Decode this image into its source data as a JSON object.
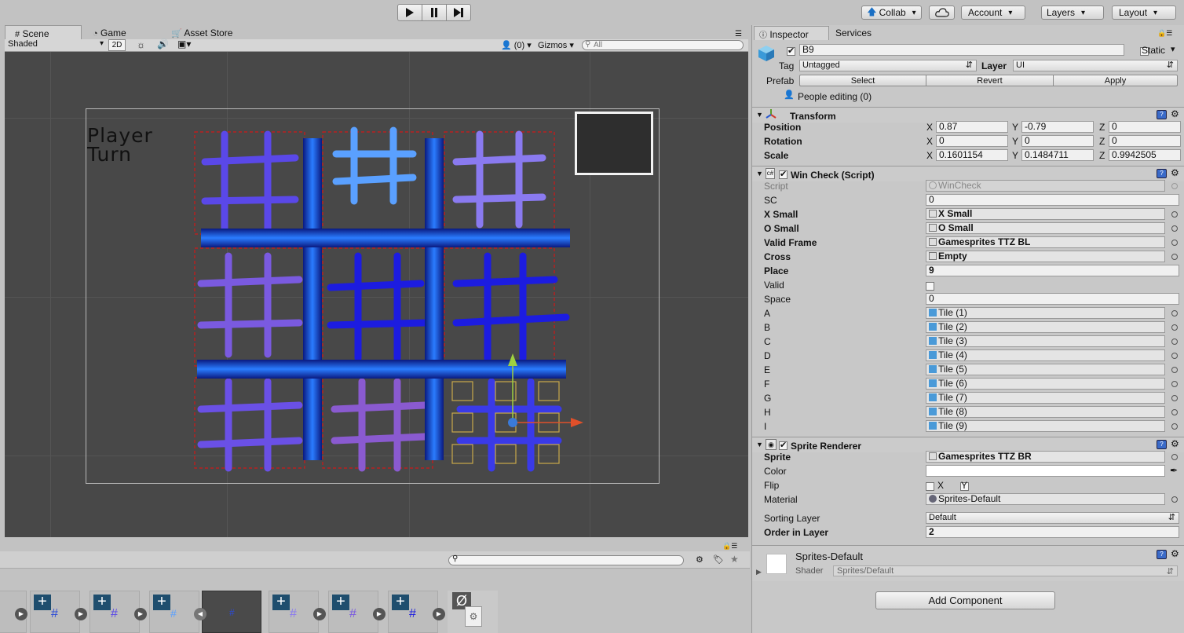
{
  "toolbar": {
    "collab": "Collab",
    "account": "Account",
    "layers": "Layers",
    "layout": "Layout"
  },
  "scene": {
    "tabs": [
      "Scene",
      "Game",
      "Asset Store"
    ],
    "shading": "Shaded",
    "mode_2d": "2D",
    "visibility_count": "(0)",
    "gizmos": "Gizmos",
    "search_placeholder": "All",
    "game_text": "Player\nTurn"
  },
  "inspector": {
    "tabs": [
      "Inspector",
      "Services"
    ],
    "object_name": "B9",
    "static_label": "Static",
    "tag_label": "Tag",
    "tag_value": "Untagged",
    "layer_label": "Layer",
    "layer_value": "UI",
    "prefab_label": "Prefab",
    "prefab_buttons": [
      "Select",
      "Revert",
      "Apply"
    ],
    "people_editing": "People editing (0)",
    "transform": {
      "title": "Transform",
      "rows": [
        {
          "label": "Position",
          "x": "0.87",
          "y": "-0.79",
          "z": "0"
        },
        {
          "label": "Rotation",
          "x": "0",
          "y": "0",
          "z": "0"
        },
        {
          "label": "Scale",
          "x": "0.1601154",
          "y": "0.1484711",
          "z": "0.9942505"
        }
      ]
    },
    "wincheck": {
      "title": "Win Check (Script)",
      "rows": [
        {
          "label": "Script",
          "value": "WinCheck",
          "kind": "script",
          "bold": false
        },
        {
          "label": "SC",
          "value": "0",
          "kind": "text",
          "bold": false
        },
        {
          "label": "X Small",
          "value": "X Small",
          "kind": "obj",
          "bold": true
        },
        {
          "label": "O Small",
          "value": "O Small",
          "kind": "obj",
          "bold": true
        },
        {
          "label": "Valid Frame",
          "value": "Gamesprites TTZ BL",
          "kind": "obj",
          "bold": true
        },
        {
          "label": "Cross",
          "value": "Empty",
          "kind": "obj",
          "bold": true
        },
        {
          "label": "Place",
          "value": "9",
          "kind": "text",
          "bold": true
        },
        {
          "label": "Valid",
          "value": "",
          "kind": "check",
          "bold": false
        },
        {
          "label": "Space",
          "value": "0",
          "kind": "text",
          "bold": false
        },
        {
          "label": "A",
          "value": "Tile (1)",
          "kind": "cube",
          "bold": false
        },
        {
          "label": "B",
          "value": "Tile (2)",
          "kind": "cube",
          "bold": false
        },
        {
          "label": "C",
          "value": "Tile (3)",
          "kind": "cube",
          "bold": false
        },
        {
          "label": "D",
          "value": "Tile (4)",
          "kind": "cube",
          "bold": false
        },
        {
          "label": "E",
          "value": "Tile (5)",
          "kind": "cube",
          "bold": false
        },
        {
          "label": "F",
          "value": "Tile (6)",
          "kind": "cube",
          "bold": false
        },
        {
          "label": "G",
          "value": "Tile (7)",
          "kind": "cube",
          "bold": false
        },
        {
          "label": "H",
          "value": "Tile (8)",
          "kind": "cube",
          "bold": false
        },
        {
          "label": "I",
          "value": "Tile (9)",
          "kind": "cube",
          "bold": false
        }
      ]
    },
    "sprite_renderer": {
      "title": "Sprite Renderer",
      "sprite_label": "Sprite",
      "sprite_value": "Gamesprites TTZ BR",
      "color_label": "Color",
      "flip_label": "Flip",
      "flip_x": "X",
      "flip_y": "Y",
      "material_label": "Material",
      "material_value": "Sprites-Default",
      "sorting_layer_label": "Sorting Layer",
      "sorting_layer_value": "Default",
      "order_label": "Order in Layer",
      "order_value": "2"
    },
    "material": {
      "name": "Sprites-Default",
      "shader_label": "Shader",
      "shader_value": "Sprites/Default"
    },
    "add_component": "Add Component"
  },
  "bottom": {
    "empty_symbol": "Ø"
  }
}
